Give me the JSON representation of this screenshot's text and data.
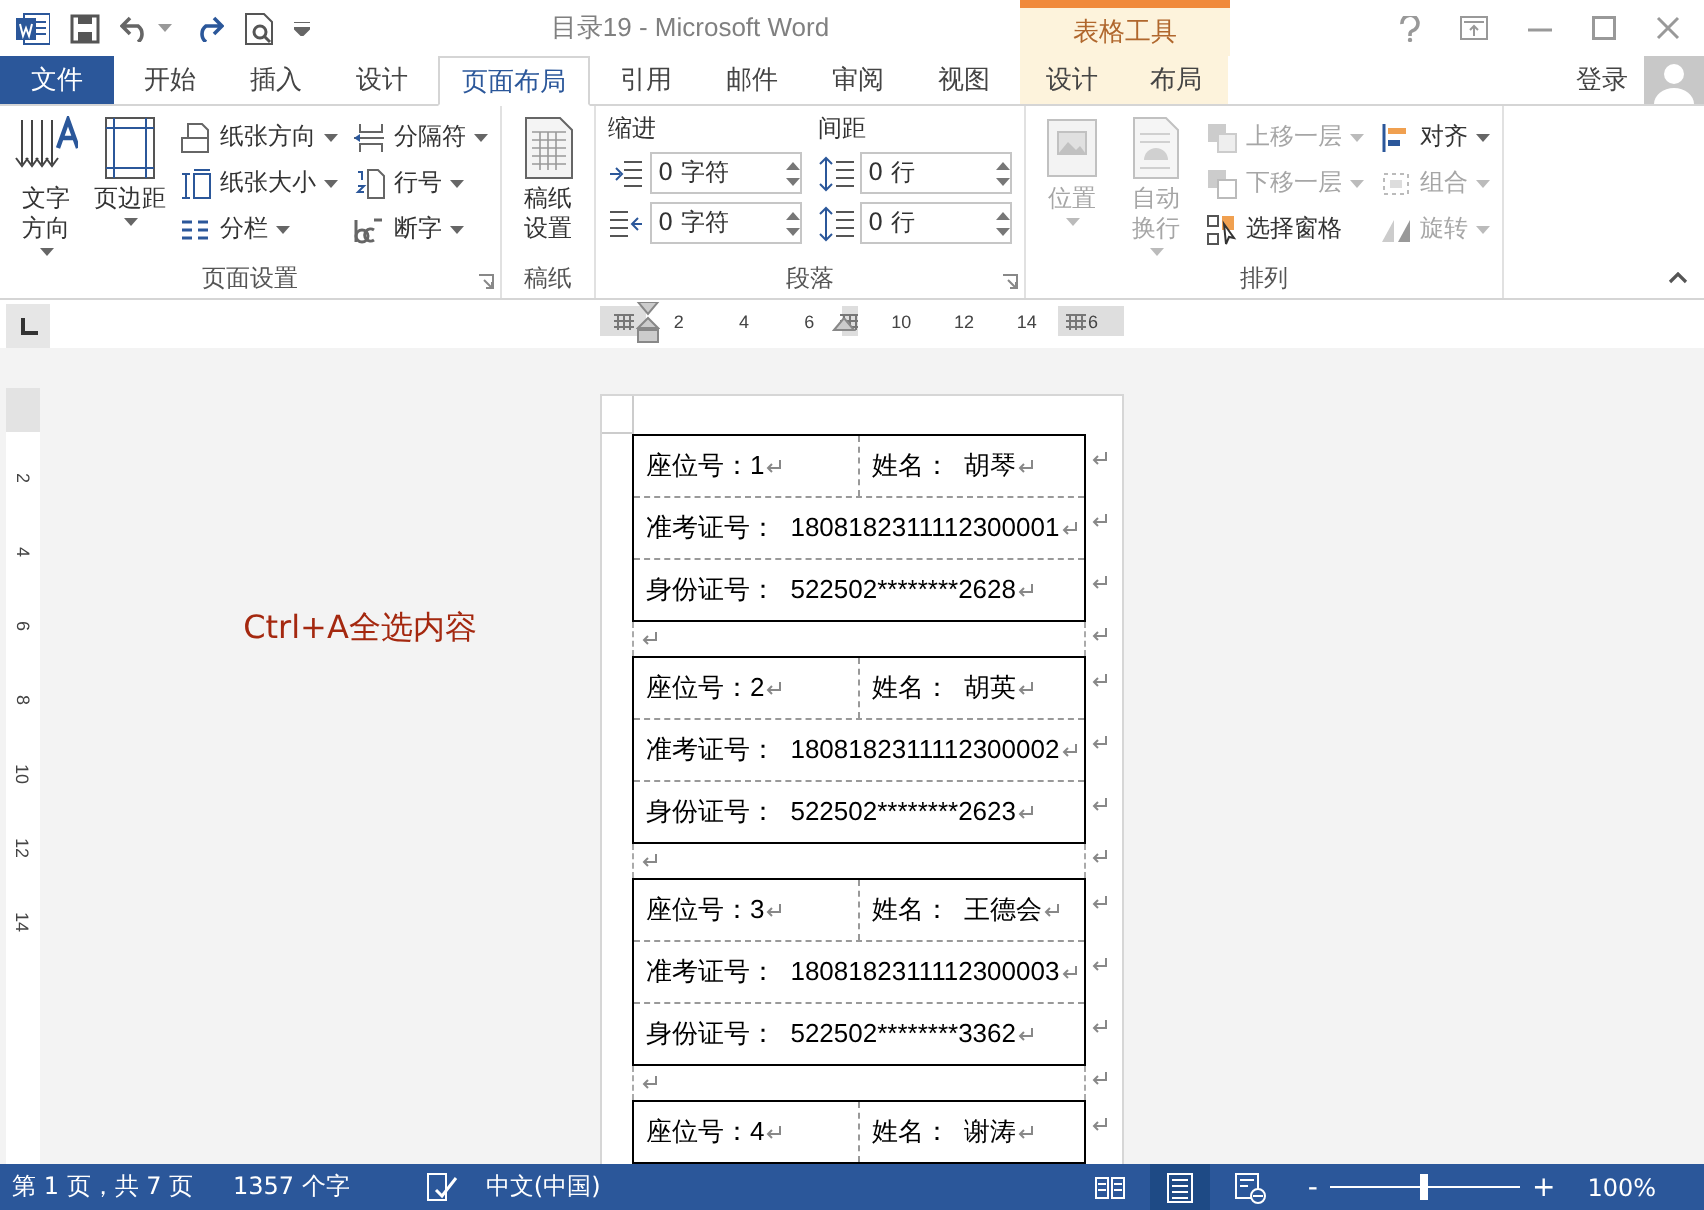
{
  "window": {
    "title": "目录19 - Microsoft Word",
    "context_group": "表格工具",
    "sign_in": "登录"
  },
  "tabs": [
    {
      "label": "文件",
      "kind": "file",
      "selected": false
    },
    {
      "label": "开始",
      "kind": "main",
      "selected": false
    },
    {
      "label": "插入",
      "kind": "main",
      "selected": false
    },
    {
      "label": "设计",
      "kind": "main",
      "selected": false
    },
    {
      "label": "页面布局",
      "kind": "main",
      "selected": true
    },
    {
      "label": "引用",
      "kind": "main",
      "selected": false
    },
    {
      "label": "邮件",
      "kind": "main",
      "selected": false
    },
    {
      "label": "审阅",
      "kind": "main",
      "selected": false
    },
    {
      "label": "视图",
      "kind": "main",
      "selected": false
    },
    {
      "label": "设计",
      "kind": "context",
      "selected": false
    },
    {
      "label": "布局",
      "kind": "context",
      "selected": false
    }
  ],
  "ribbon": {
    "groups": [
      {
        "label": "页面设置",
        "launcher": true,
        "large": [
          {
            "label": "文字方向",
            "dropdown": true,
            "disabled": false
          },
          {
            "label": "页边距",
            "dropdown": true,
            "disabled": false
          }
        ],
        "columns": [
          [
            {
              "label": "纸张方向",
              "dropdown": true,
              "disabled": false
            },
            {
              "label": "纸张大小",
              "dropdown": true,
              "disabled": false
            },
            {
              "label": "分栏",
              "dropdown": true,
              "disabled": false
            }
          ],
          [
            {
              "label": "分隔符",
              "dropdown": true,
              "disabled": false
            },
            {
              "label": "行号",
              "dropdown": true,
              "disabled": false
            },
            {
              "label": "断字",
              "dropdown": true,
              "disabled": false
            }
          ]
        ]
      },
      {
        "label": "稿纸",
        "launcher": false,
        "large": [
          {
            "label": "稿纸设置",
            "dropdown": false,
            "disabled": false
          }
        ]
      },
      {
        "label": "段落",
        "launcher": true,
        "spin_sections": [
          {
            "heading": "缩进",
            "fields": [
              {
                "value": "0 字符"
              },
              {
                "value": "0 字符"
              }
            ]
          },
          {
            "heading": "间距",
            "fields": [
              {
                "value": "0 行"
              },
              {
                "value": "0 行"
              }
            ]
          }
        ]
      },
      {
        "label": "排列",
        "launcher": false,
        "large": [
          {
            "label": "位置",
            "dropdown": true,
            "disabled": true
          },
          {
            "label": "自动换行",
            "dropdown": true,
            "disabled": true
          }
        ],
        "columns": [
          [
            {
              "label": "上移一层",
              "dropdown": true,
              "disabled": true
            },
            {
              "label": "下移一层",
              "dropdown": true,
              "disabled": true
            },
            {
              "label": "选择窗格",
              "dropdown": false,
              "disabled": false
            }
          ],
          [
            {
              "label": "对齐",
              "dropdown": true,
              "disabled": false
            },
            {
              "label": "组合",
              "dropdown": true,
              "disabled": true
            },
            {
              "label": "旋转",
              "dropdown": true,
              "disabled": true
            }
          ]
        ]
      }
    ]
  },
  "ruler": {
    "labels": [
      "2",
      "4",
      "6",
      "10",
      "12",
      "14",
      "6"
    ],
    "vertical_labels": [
      "2",
      "4",
      "6",
      "8",
      "10",
      "12",
      "14"
    ]
  },
  "hint": "Ctrl+A全选内容",
  "document": {
    "show_formatting_marks": true,
    "cards": [
      {
        "rows": [
          {
            "cells": [
              "座位号：1",
              "姓名：  胡琴"
            ]
          },
          {
            "cells": [
              "准考证号：  1808182311112300001"
            ]
          },
          {
            "cells": [
              "身份证号：  522502********2628"
            ]
          }
        ]
      },
      {
        "rows": [
          {
            "cells": [
              "座位号：2",
              "姓名：  胡英"
            ]
          },
          {
            "cells": [
              "准考证号：  1808182311112300002"
            ]
          },
          {
            "cells": [
              "身份证号：  522502********2623"
            ]
          }
        ]
      },
      {
        "rows": [
          {
            "cells": [
              "座位号：3",
              "姓名：  王德会"
            ]
          },
          {
            "cells": [
              "准考证号：  1808182311112300003"
            ]
          },
          {
            "cells": [
              "身份证号：  522502********3362"
            ]
          }
        ]
      },
      {
        "rows": [
          {
            "cells": [
              "座位号：4",
              "姓名：  谢涛"
            ]
          }
        ]
      }
    ]
  },
  "status_bar": {
    "page": "第 1 页，共 7 页",
    "words": "1357 个字",
    "language": "中文(中国)",
    "views": [
      {
        "selected": false
      },
      {
        "selected": true
      },
      {
        "selected": false
      }
    ],
    "zoom_out": "-",
    "zoom_in": "+",
    "zoom": {
      "level": 0.5
    },
    "zoom_text": "100%"
  }
}
